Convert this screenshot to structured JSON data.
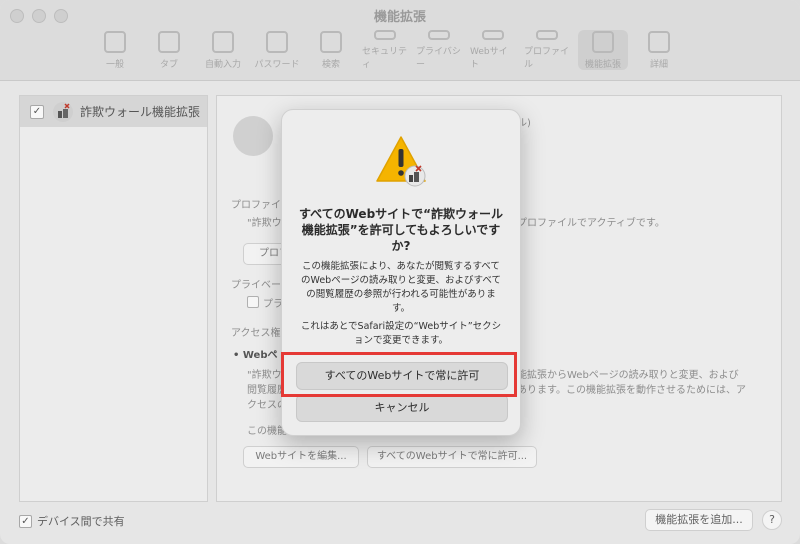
{
  "window": {
    "title": "機能拡張"
  },
  "toolbar": {
    "items": [
      "一般",
      "タブ",
      "自動入力",
      "パスワード",
      "検索",
      "セキュリティ",
      "プライバシー",
      "Webサイト",
      "プロファイル",
      "機能拡張",
      "詳細"
    ]
  },
  "sidebar": {
    "items": [
      {
        "label": "詐欺ウォール機能拡張",
        "checked": true
      }
    ]
  },
  "content": {
    "profile_section": "プロファイ",
    "profile_desc_left": "\"詐欺ウォ",
    "profile_desc_right": "プロファイルでアクティブです。",
    "profile_button": "プロフ",
    "privacy_section": "プライベー",
    "privacy_check_label": "プラ",
    "access_section": "アクセス権",
    "web_bullet": "• Webペ",
    "web_desc_left1": "\"詐欺ウ",
    "web_desc_right1": "能拡張からWebページの読み取りと変更、および",
    "web_desc_left2": "閲覧履歴",
    "web_desc_right2": "あります。この機能拡張を動作させるためには、ア",
    "web_desc_left3": "クセスの",
    "this_ext": "この機能",
    "edit_button": "Webサイトを編集...",
    "allow_all_button": "すべてのWebサイトで常に許可...",
    "header_fragment": "ル)"
  },
  "dialog": {
    "title": "すべてのWebサイトで“詐欺ウォール機能拡張”を許可してもよろしいですか?",
    "body": "この機能拡張により、あなたが閲覧するすべてのWebページの読み取りと変更、およびすべての閲覧履歴の参照が行われる可能性があります。",
    "body2": "これはあとでSafari設定の“Webサイト”セクションで変更できます。",
    "allow_label": "すべてのWebサイトで常に許可",
    "cancel_label": "キャンセル"
  },
  "footer": {
    "share_label": "デバイス間で共有",
    "add_button": "機能拡張を追加...",
    "help": "?"
  },
  "colors": {
    "highlight": "#e53935",
    "warning": "#f5b400"
  }
}
